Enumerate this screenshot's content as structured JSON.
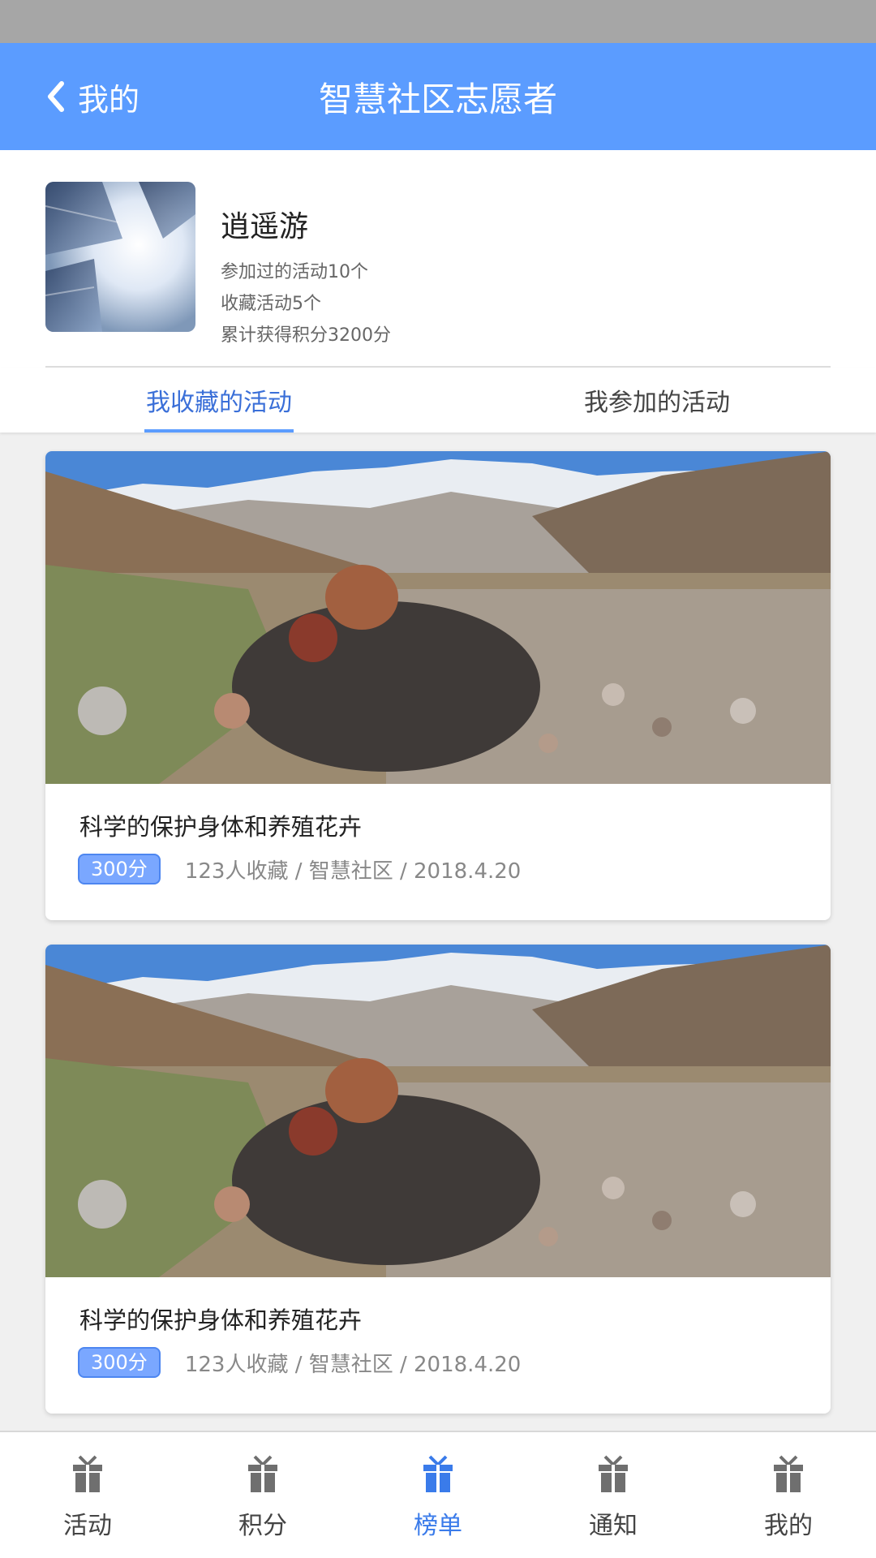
{
  "header": {
    "back_label": "我的",
    "title": "智慧社区志愿者"
  },
  "profile": {
    "name": "逍遥游",
    "joined": "参加过的活动10个",
    "favorites": "收藏活动5个",
    "points": "累计获得积分3200分"
  },
  "tabs": [
    {
      "label": "我收藏的活动",
      "active": true
    },
    {
      "label": "我参加的活动",
      "active": false
    }
  ],
  "cards": [
    {
      "title": "科学的保护身体和养殖花卉",
      "points": "300分",
      "meta": "123人收藏 / 智慧社区 / 2018.4.20"
    },
    {
      "title": "科学的保护身体和养殖花卉",
      "points": "300分",
      "meta": "123人收藏 / 智慧社区 / 2018.4.20"
    }
  ],
  "bottom_nav": [
    {
      "label": "活动",
      "icon": "gift-icon",
      "active": false
    },
    {
      "label": "积分",
      "icon": "gift-icon",
      "active": false
    },
    {
      "label": "榜单",
      "icon": "gift-icon",
      "active": true
    },
    {
      "label": "通知",
      "icon": "gift-icon",
      "active": false
    },
    {
      "label": "我的",
      "icon": "gift-icon",
      "active": false
    }
  ],
  "colors": {
    "primary": "#5b9cff",
    "active_nav": "#3a7bea",
    "inactive_icon": "#6f6f6f",
    "status_bar": "#a6a6a6"
  }
}
